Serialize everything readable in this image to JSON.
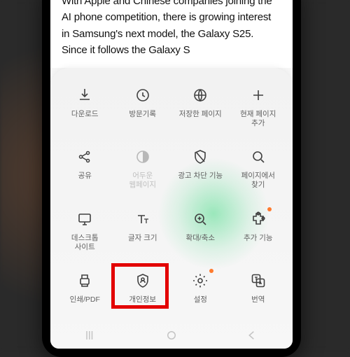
{
  "article": {
    "text": "With Apple and Chinese companies joining the AI phone competition, there is growing interest in Samsung's next model, the Galaxy S25. Since it follows the Galaxy S"
  },
  "menu": {
    "items": [
      {
        "id": "download",
        "label": "다운로드"
      },
      {
        "id": "history",
        "label": "방문기록"
      },
      {
        "id": "saved-pages",
        "label": "저장한 페이지"
      },
      {
        "id": "add-page",
        "label": "현재 페이지\n추가"
      },
      {
        "id": "share",
        "label": "공유"
      },
      {
        "id": "dark-mode",
        "label": "어두운\n웹페이지",
        "disabled": true
      },
      {
        "id": "ad-block",
        "label": "광고 차단 기능"
      },
      {
        "id": "find-in-page",
        "label": "페이지에서\n찾기"
      },
      {
        "id": "desktop-site",
        "label": "데스크톱\n사이트"
      },
      {
        "id": "text-size",
        "label": "글자 크기"
      },
      {
        "id": "zoom",
        "label": "확대/축소"
      },
      {
        "id": "addons",
        "label": "추가 기능",
        "dot": true
      },
      {
        "id": "print-pdf",
        "label": "인쇄/PDF"
      },
      {
        "id": "privacy",
        "label": "개인정보",
        "highlighted": true
      },
      {
        "id": "settings",
        "label": "설정",
        "dot": true
      },
      {
        "id": "translate",
        "label": "번역"
      }
    ]
  }
}
